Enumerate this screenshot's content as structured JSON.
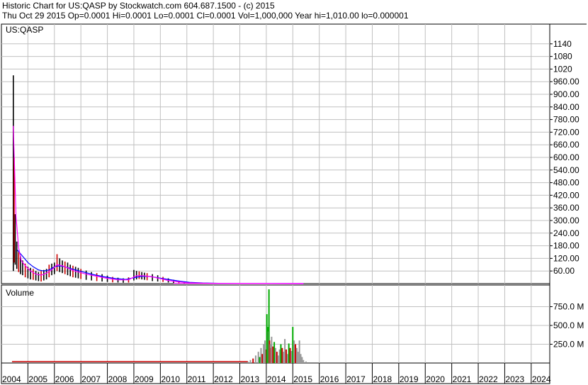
{
  "header": {
    "line1": "Historic Chart for US:QASP by Stockwatch.com 604.687.1500 - (c) 2015",
    "line2": "Thu Oct 29 2015   Op=0.0001   Hi=0.0001   Lo=0.0001   Cl=0.0001   Vol=1,000,000   Year hi=1,010.00   lo=0.000001"
  },
  "colors": {
    "up_bar": "#000000",
    "down_bar": "#cc0000",
    "ma_fast": "#ff00ff",
    "ma_slow": "#0000ff",
    "volume_up": "#00aa00",
    "volume_down": "#cc0000",
    "volume_neutral": "#999999",
    "grid": "#c0c0c0"
  },
  "chart_data": [
    {
      "type": "line",
      "title": "US:QASP",
      "ylim": [
        0,
        1200
      ],
      "y_ticks": [
        60,
        120,
        180,
        240,
        300,
        360,
        420,
        480,
        540,
        600,
        660,
        720,
        780,
        840,
        900,
        960,
        1020,
        1080,
        1140
      ],
      "y_tick_labels": [
        "60.00",
        "120.00",
        "180.00",
        "240.00",
        "300.00",
        "360.00",
        "420.00",
        "480.00",
        "540.00",
        "600.00",
        "660.00",
        "720.00",
        "780.00",
        "840.00",
        "900.00",
        "960.00",
        "1020",
        "1080",
        "1140"
      ],
      "x_range": [
        2004.0,
        2024.7
      ],
      "x_ticks": [
        2004,
        2005,
        2006,
        2007,
        2008,
        2009,
        2010,
        2011,
        2012,
        2013,
        2014,
        2015,
        2016,
        2017,
        2018,
        2019,
        2020,
        2021,
        2022,
        2023,
        2024
      ],
      "x_tick_labels": [
        "2004",
        "2005",
        "2006",
        "2007",
        "2008",
        "2009",
        "2010",
        "2011",
        "2012",
        "2013",
        "2014",
        "2015",
        "2016",
        "2017",
        "2018",
        "2019",
        "2020",
        "2021",
        "2022",
        "2023",
        "2024"
      ],
      "grid": true,
      "price_hl": [
        [
          2004.45,
          990,
          60
        ],
        [
          2004.48,
          600,
          100
        ],
        [
          2004.52,
          330,
          90
        ],
        [
          2004.58,
          200,
          70
        ],
        [
          2004.65,
          150,
          55
        ],
        [
          2004.72,
          130,
          45
        ],
        [
          2004.8,
          110,
          40
        ],
        [
          2004.9,
          95,
          30
        ],
        [
          2005.0,
          80,
          25
        ],
        [
          2005.1,
          75,
          20
        ],
        [
          2005.2,
          70,
          18
        ],
        [
          2005.3,
          60,
          15
        ],
        [
          2005.4,
          55,
          12
        ],
        [
          2005.5,
          60,
          10
        ],
        [
          2005.6,
          65,
          15
        ],
        [
          2005.7,
          70,
          20
        ],
        [
          2005.8,
          90,
          30
        ],
        [
          2005.9,
          95,
          40
        ],
        [
          2006.0,
          100,
          45
        ],
        [
          2006.1,
          140,
          60
        ],
        [
          2006.2,
          120,
          55
        ],
        [
          2006.3,
          110,
          50
        ],
        [
          2006.4,
          105,
          45
        ],
        [
          2006.5,
          100,
          40
        ],
        [
          2006.6,
          90,
          35
        ],
        [
          2006.7,
          85,
          30
        ],
        [
          2006.8,
          80,
          28
        ],
        [
          2006.9,
          75,
          25
        ],
        [
          2007.0,
          70,
          22
        ],
        [
          2007.2,
          62,
          18
        ],
        [
          2007.4,
          55,
          15
        ],
        [
          2007.6,
          50,
          12
        ],
        [
          2007.8,
          45,
          10
        ],
        [
          2008.0,
          38,
          8
        ],
        [
          2008.2,
          32,
          6
        ],
        [
          2008.4,
          28,
          5
        ],
        [
          2008.6,
          25,
          4
        ],
        [
          2008.8,
          30,
          5
        ],
        [
          2009.0,
          65,
          15
        ],
        [
          2009.1,
          60,
          20
        ],
        [
          2009.2,
          58,
          22
        ],
        [
          2009.3,
          55,
          20
        ],
        [
          2009.4,
          52,
          18
        ],
        [
          2009.5,
          50,
          16
        ],
        [
          2009.7,
          45,
          12
        ],
        [
          2009.9,
          40,
          10
        ],
        [
          2010.1,
          32,
          8
        ],
        [
          2010.3,
          25,
          5
        ],
        [
          2010.5,
          18,
          3
        ],
        [
          2010.7,
          12,
          2
        ],
        [
          2010.9,
          8,
          1
        ],
        [
          2011.2,
          5,
          0.5
        ],
        [
          2011.6,
          3,
          0.3
        ],
        [
          2012.0,
          2,
          0.2
        ],
        [
          2012.5,
          1.5,
          0.1
        ],
        [
          2013.0,
          1,
          0.05
        ],
        [
          2013.5,
          0.8,
          0.01
        ],
        [
          2014.0,
          0.5,
          0.01
        ],
        [
          2014.5,
          0.3,
          0.001
        ],
        [
          2015.0,
          0.2,
          0.0001
        ],
        [
          2015.4,
          0.1,
          0.0001
        ]
      ],
      "ma_fast": [
        [
          2004.45,
          750
        ],
        [
          2004.55,
          320
        ],
        [
          2004.65,
          170
        ],
        [
          2004.75,
          110
        ],
        [
          2004.9,
          85
        ],
        [
          2005.1,
          60
        ],
        [
          2005.3,
          45
        ],
        [
          2005.5,
          40
        ],
        [
          2005.7,
          50
        ],
        [
          2005.9,
          65
        ],
        [
          2006.1,
          90
        ],
        [
          2006.3,
          85
        ],
        [
          2006.5,
          75
        ],
        [
          2006.7,
          62
        ],
        [
          2006.9,
          55
        ],
        [
          2007.2,
          45
        ],
        [
          2007.6,
          35
        ],
        [
          2008.0,
          25
        ],
        [
          2008.4,
          18
        ],
        [
          2008.8,
          18
        ],
        [
          2009.1,
          38
        ],
        [
          2009.4,
          37
        ],
        [
          2009.7,
          32
        ],
        [
          2010.0,
          24
        ],
        [
          2010.3,
          15
        ],
        [
          2010.7,
          8
        ],
        [
          2011.0,
          4
        ],
        [
          2011.5,
          2
        ],
        [
          2012.0,
          1
        ],
        [
          2013.0,
          0.5
        ],
        [
          2014.0,
          0.3
        ],
        [
          2015.0,
          0.1
        ],
        [
          2015.4,
          0.1
        ]
      ],
      "ma_slow": [
        [
          2004.6,
          160
        ],
        [
          2004.8,
          130
        ],
        [
          2005.0,
          100
        ],
        [
          2005.2,
          80
        ],
        [
          2005.4,
          65
        ],
        [
          2005.6,
          60
        ],
        [
          2005.8,
          65
        ],
        [
          2006.0,
          80
        ],
        [
          2006.2,
          85
        ],
        [
          2006.4,
          80
        ],
        [
          2006.6,
          72
        ],
        [
          2006.8,
          65
        ],
        [
          2007.1,
          55
        ],
        [
          2007.5,
          42
        ],
        [
          2007.9,
          32
        ],
        [
          2008.3,
          24
        ],
        [
          2008.7,
          20
        ],
        [
          2009.0,
          28
        ],
        [
          2009.3,
          35
        ],
        [
          2009.6,
          34
        ],
        [
          2009.9,
          28
        ],
        [
          2010.3,
          20
        ],
        [
          2010.7,
          12
        ],
        [
          2011.1,
          6
        ],
        [
          2011.6,
          3
        ],
        [
          2012.2,
          1.5
        ],
        [
          2013.0,
          0.8
        ],
        [
          2014.0,
          0.4
        ],
        [
          2015.0,
          0.2
        ],
        [
          2015.4,
          0.15
        ]
      ]
    },
    {
      "type": "bar",
      "title": "Volume",
      "ylim": [
        0,
        1000000000
      ],
      "y_ticks": [
        250000000,
        500000000,
        750000000
      ],
      "y_tick_labels": [
        "250.0 M",
        "500.0 M",
        "750.0 M"
      ],
      "volume": [
        [
          2013.3,
          20000000,
          "neutral"
        ],
        [
          2013.4,
          40000000,
          "neutral"
        ],
        [
          2013.5,
          60000000,
          "down"
        ],
        [
          2013.6,
          100000000,
          "neutral"
        ],
        [
          2013.7,
          150000000,
          "neutral"
        ],
        [
          2013.75,
          80000000,
          "up"
        ],
        [
          2013.8,
          200000000,
          "neutral"
        ],
        [
          2013.85,
          120000000,
          "down"
        ],
        [
          2013.9,
          250000000,
          "neutral"
        ],
        [
          2013.95,
          300000000,
          "neutral"
        ],
        [
          2014.0,
          180000000,
          "down"
        ],
        [
          2014.02,
          650000000,
          "up"
        ],
        [
          2014.05,
          480000000,
          "up"
        ],
        [
          2014.08,
          420000000,
          "neutral"
        ],
        [
          2014.1,
          980000000,
          "up"
        ],
        [
          2014.12,
          300000000,
          "down"
        ],
        [
          2014.15,
          250000000,
          "neutral"
        ],
        [
          2014.18,
          200000000,
          "down"
        ],
        [
          2014.2,
          350000000,
          "neutral"
        ],
        [
          2014.25,
          220000000,
          "down"
        ],
        [
          2014.3,
          280000000,
          "up"
        ],
        [
          2014.35,
          200000000,
          "neutral"
        ],
        [
          2014.4,
          150000000,
          "down"
        ],
        [
          2014.45,
          100000000,
          "neutral"
        ],
        [
          2014.5,
          180000000,
          "neutral"
        ],
        [
          2014.55,
          250000000,
          "up"
        ],
        [
          2014.6,
          200000000,
          "down"
        ],
        [
          2014.65,
          150000000,
          "neutral"
        ],
        [
          2014.7,
          320000000,
          "neutral"
        ],
        [
          2014.75,
          180000000,
          "down"
        ],
        [
          2014.8,
          120000000,
          "neutral"
        ],
        [
          2014.85,
          260000000,
          "up"
        ],
        [
          2014.9,
          200000000,
          "down"
        ],
        [
          2014.95,
          160000000,
          "neutral"
        ],
        [
          2015.0,
          480000000,
          "up"
        ],
        [
          2015.05,
          300000000,
          "neutral"
        ],
        [
          2015.1,
          250000000,
          "down"
        ],
        [
          2015.15,
          200000000,
          "neutral"
        ],
        [
          2015.2,
          150000000,
          "neutral"
        ],
        [
          2015.25,
          300000000,
          "neutral"
        ],
        [
          2015.3,
          120000000,
          "neutral"
        ],
        [
          2015.35,
          80000000,
          "neutral"
        ],
        [
          2015.4,
          40000000,
          "neutral"
        ],
        [
          2015.5,
          20000000,
          "neutral"
        ]
      ]
    }
  ]
}
